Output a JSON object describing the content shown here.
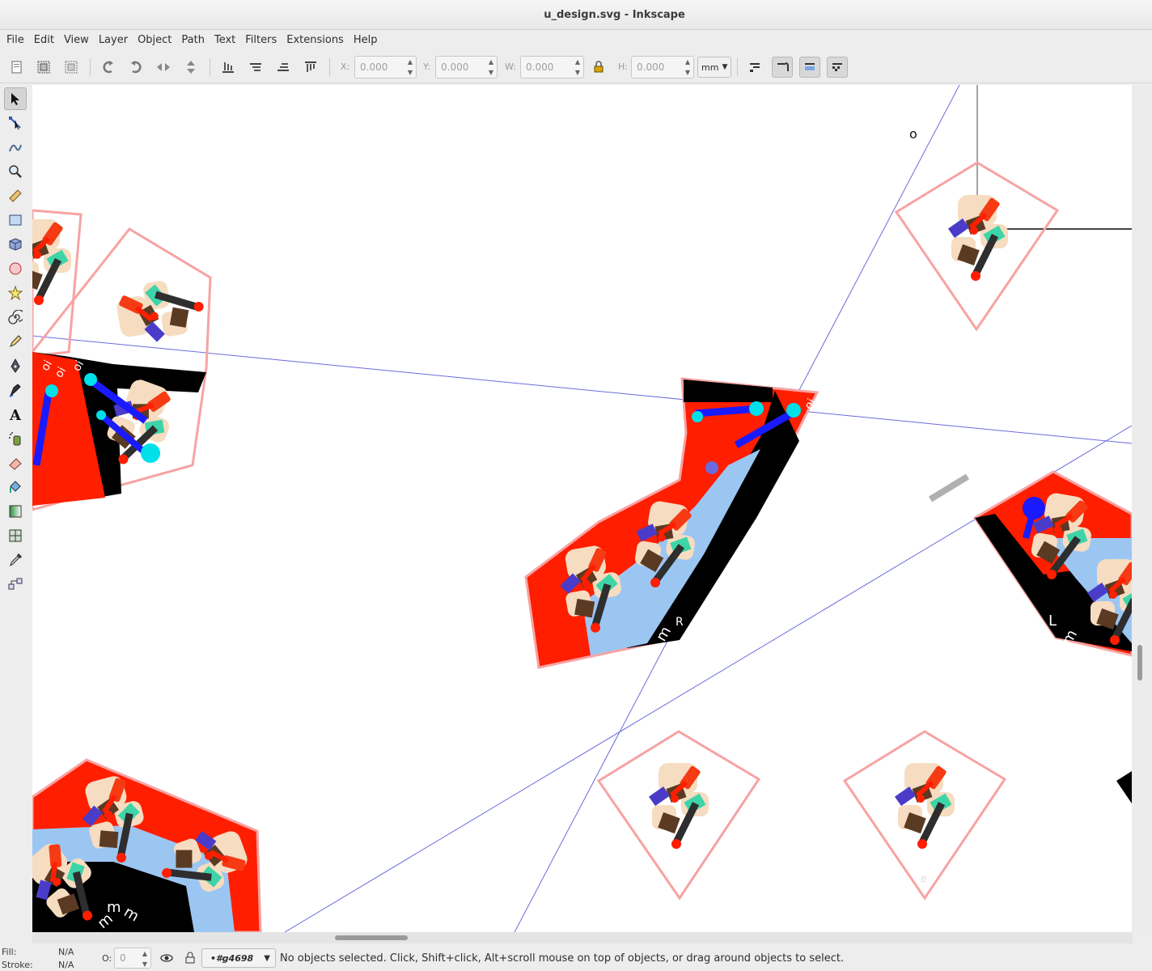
{
  "window": {
    "title": "u_design.svg - Inkscape"
  },
  "menu": [
    "File",
    "Edit",
    "View",
    "Layer",
    "Object",
    "Path",
    "Text",
    "Filters",
    "Extensions",
    "Help"
  ],
  "toolbar": {
    "x_label": "X:",
    "x_value": "0.000",
    "y_label": "Y:",
    "y_value": "0.000",
    "w_label": "W:",
    "w_value": "0.000",
    "h_label": "H:",
    "h_value": "0.000",
    "unit": "mm"
  },
  "canvas": {
    "labels": {
      "o_top": "o",
      "r_label": "R",
      "l_label": "L"
    }
  },
  "status": {
    "fill_label": "Fill:",
    "fill_value": "N/A",
    "stroke_label": "Stroke:",
    "stroke_value": "N/A",
    "opacity_label": "O:",
    "opacity_value": "0",
    "layer": "•#g4698",
    "message": "No objects selected. Click, Shift+click, Alt+scroll mouse on top of objects, or drag around objects to select."
  }
}
